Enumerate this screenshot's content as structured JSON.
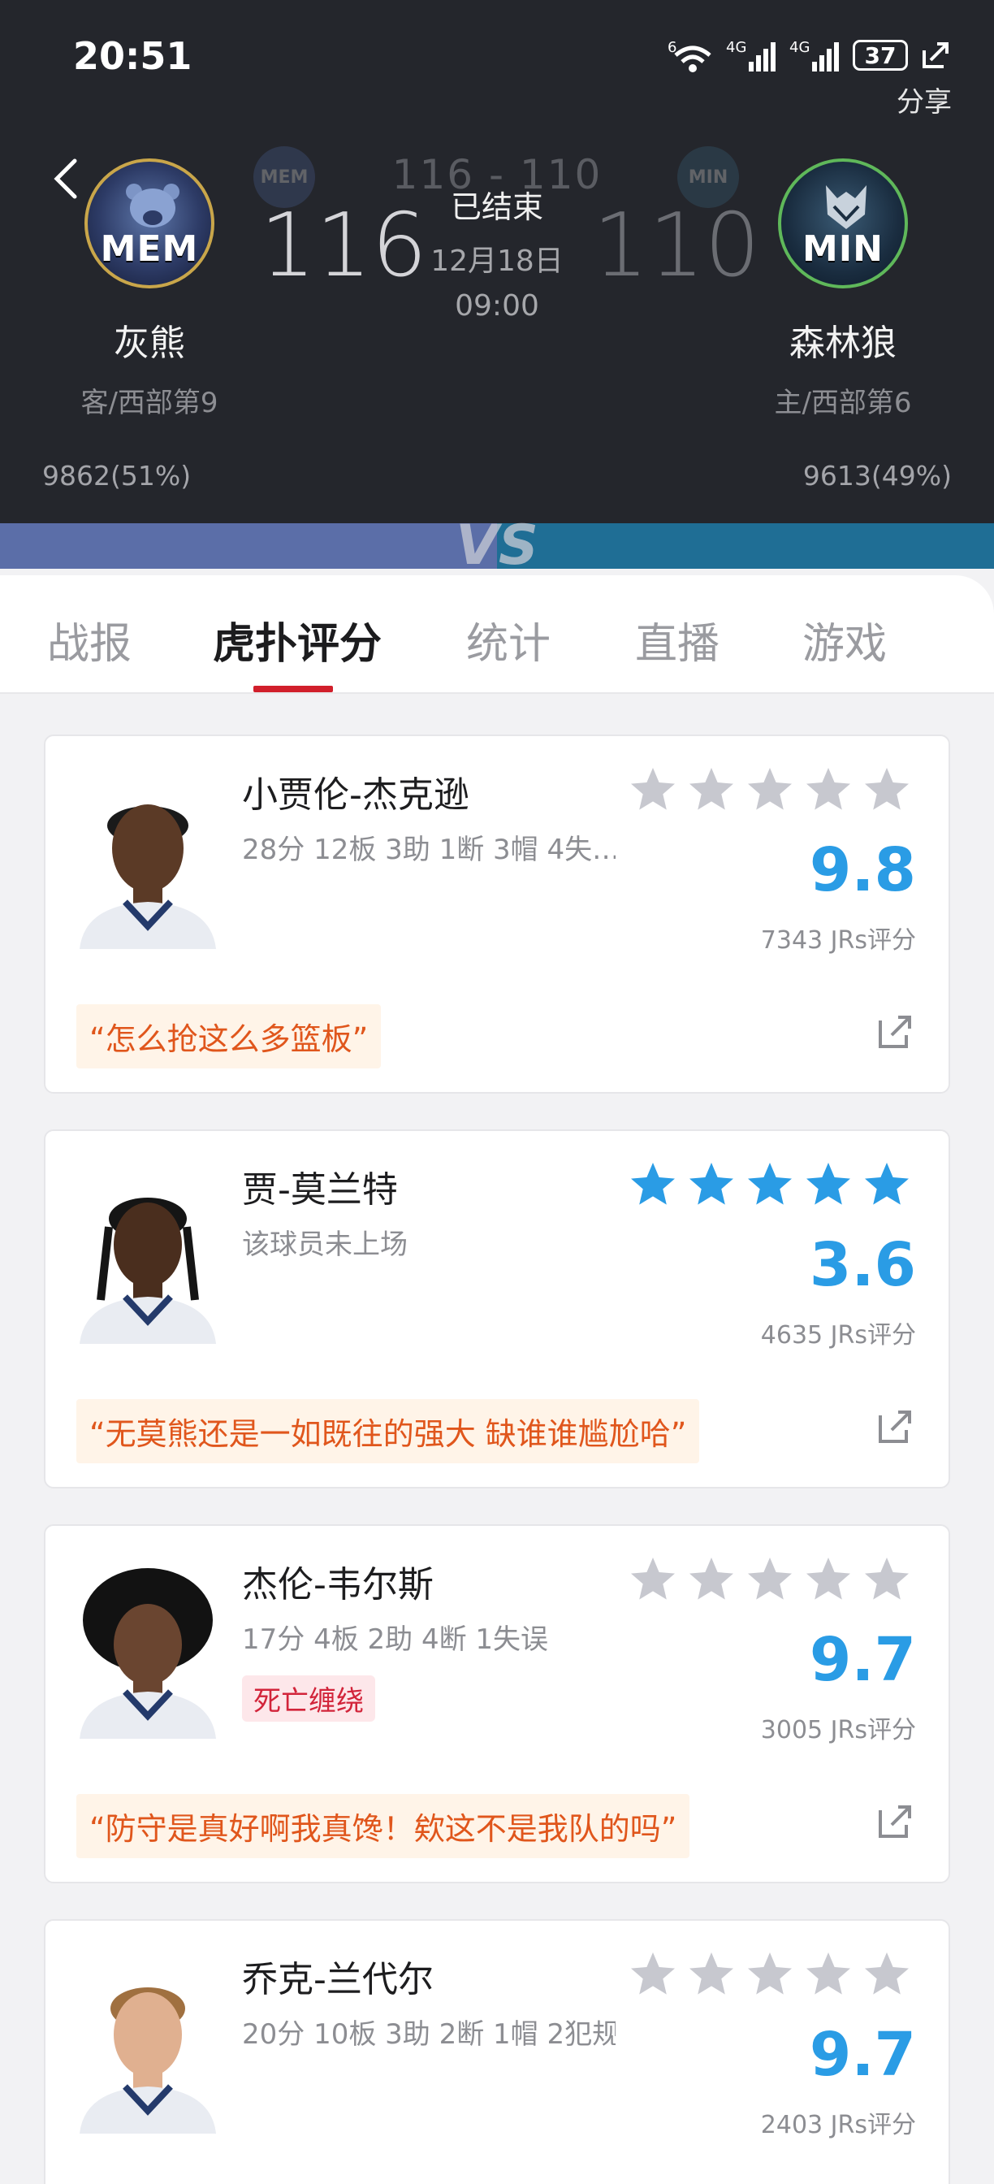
{
  "status_bar": {
    "time": "20:51",
    "battery": "37",
    "signal_labels": [
      "6",
      "4G",
      "4G"
    ]
  },
  "header": {
    "share_label": "分享",
    "score_line": "116 - 110",
    "status": "已结束",
    "date": "12月18日",
    "time": "09:00",
    "vs": "VS",
    "home_team": {
      "abbr": "MEM",
      "name": "灰熊",
      "rank": "客/西部第9",
      "score": "116",
      "support": "9862(51%)"
    },
    "away_team": {
      "abbr": "MIN",
      "name": "森林狼",
      "rank": "主/西部第6",
      "score": "110",
      "support": "9613(49%)"
    }
  },
  "tabs": [
    {
      "label": "战报",
      "active": false
    },
    {
      "label": "虎扑评分",
      "active": true
    },
    {
      "label": "统计",
      "active": false
    },
    {
      "label": "直播",
      "active": false
    },
    {
      "label": "游戏",
      "active": false
    }
  ],
  "players": [
    {
      "name": "小贾伦-杰克逊",
      "line": "28分 12板 3助 1断 3帽 4失…",
      "tag": "",
      "rating": "9.8",
      "rating_count": "7343 JRs评分",
      "stars_filled": 0,
      "quote": "“怎么抢这么多篮板”"
    },
    {
      "name": "贾-莫兰特",
      "line": "该球员未上场",
      "tag": "",
      "rating": "3.6",
      "rating_count": "4635 JRs评分",
      "stars_filled": 5,
      "quote": "“无莫熊还是一如既往的强大 缺谁谁尴尬哈”"
    },
    {
      "name": "杰伦-韦尔斯",
      "line": "17分 4板 2助 4断 1失误",
      "tag": "死亡缠绕",
      "rating": "9.7",
      "rating_count": "3005 JRs评分",
      "stars_filled": 0,
      "quote": "“防守是真好啊我真馋！欸这不是我队的吗”"
    },
    {
      "name": "乔克-兰代尔",
      "line": "20分 10板 3助 2断 1帽 2犯规",
      "tag": "",
      "rating": "9.7",
      "rating_count": "2403 JRs评分",
      "stars_filled": 0,
      "quote": ""
    }
  ],
  "colors": {
    "accent_blue": "#2a9ce5",
    "quote_orange": "#e0561c",
    "tab_indicator": "#d11f2b",
    "header_bg": "#24262c"
  },
  "icons": [
    "wifi-icon",
    "signal-icon",
    "battery-icon",
    "share-icon",
    "back-icon",
    "star-icon",
    "external-link-icon"
  ]
}
